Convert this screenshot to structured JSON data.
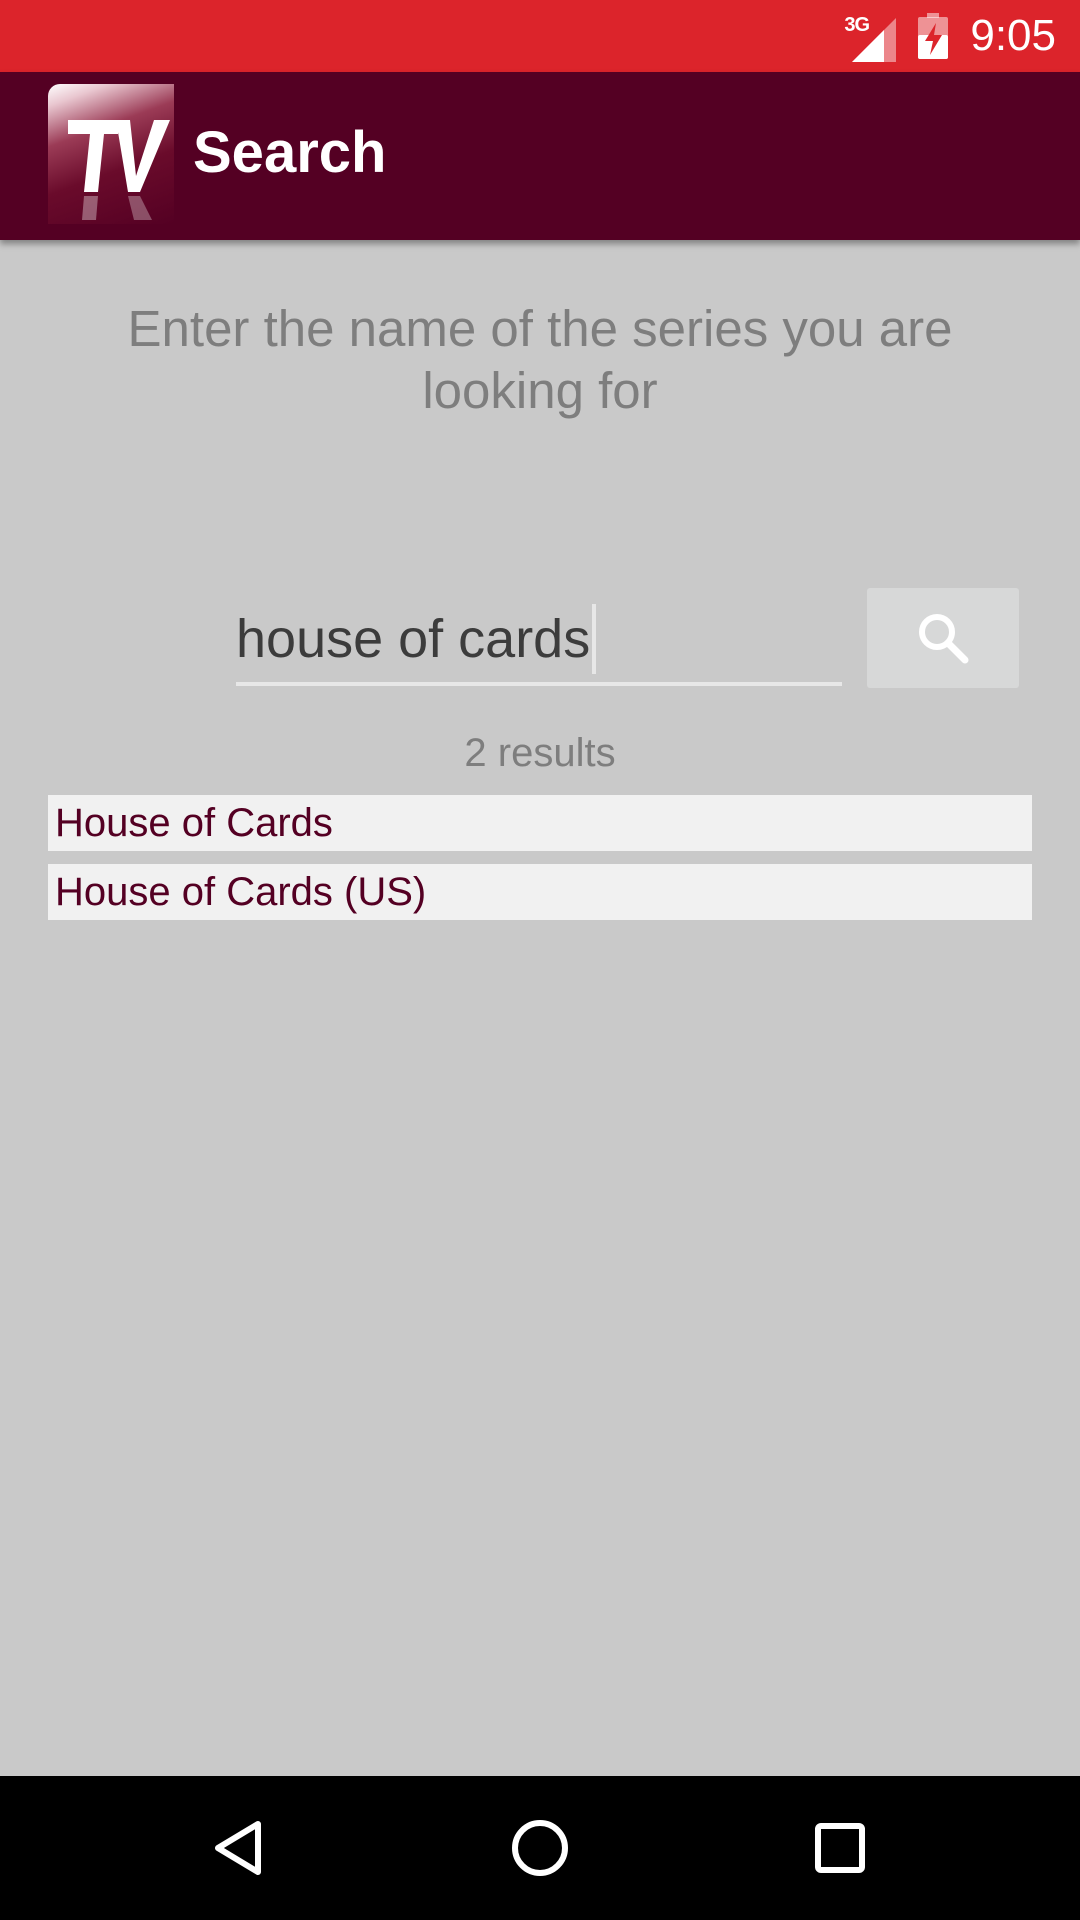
{
  "status_bar": {
    "network": "3G",
    "time": "9:05",
    "icons": [
      "signal-icon",
      "battery-charging-icon"
    ]
  },
  "app_bar": {
    "logo_text": "TV",
    "title": "Search",
    "color": "#540023"
  },
  "prompt": "Enter the name of the series you are looking for",
  "search": {
    "value": "house of cards",
    "button_icon": "search-icon"
  },
  "results": {
    "count_text": "2 results",
    "items": [
      {
        "label": "House of Cards"
      },
      {
        "label": "House of Cards (US)"
      }
    ]
  },
  "nav_bar": {
    "icons": [
      "back-icon",
      "home-icon",
      "recents-icon"
    ]
  },
  "colors": {
    "status_bar": "#dc242b",
    "accent": "#540023",
    "background": "#c9c9c9"
  }
}
